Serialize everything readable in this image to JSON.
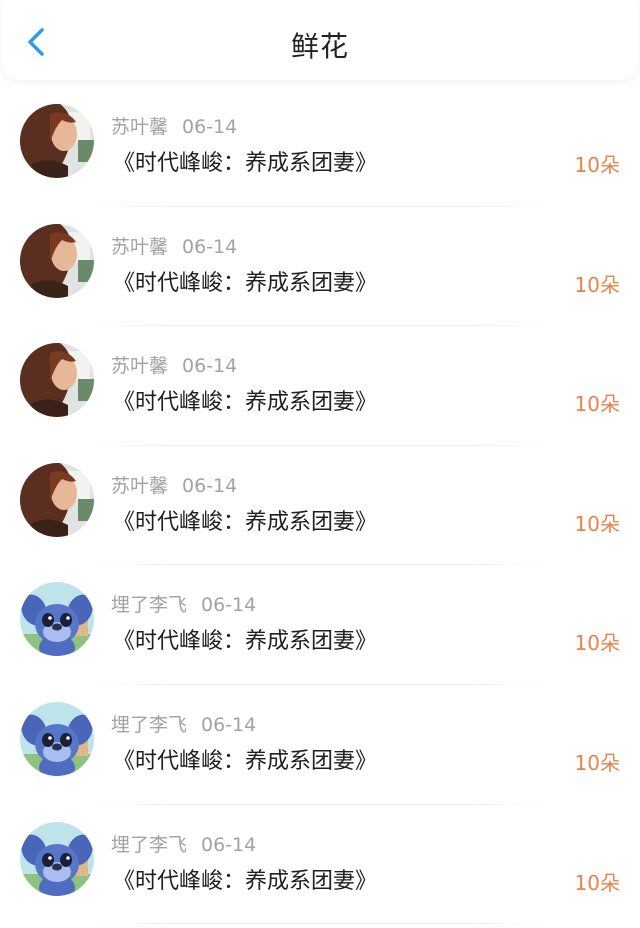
{
  "header": {
    "title": "鲜花",
    "back_icon": "chevron-left-icon",
    "accent_color": "#2b9de8"
  },
  "flowers": [
    {
      "user": "苏叶馨",
      "date": "06-14",
      "book": "《时代峰峻：养成系团妻》",
      "count": "10朵",
      "avatar": "woman-photo-avatar"
    },
    {
      "user": "苏叶馨",
      "date": "06-14",
      "book": "《时代峰峻：养成系团妻》",
      "count": "10朵",
      "avatar": "woman-photo-avatar"
    },
    {
      "user": "苏叶馨",
      "date": "06-14",
      "book": "《时代峰峻：养成系团妻》",
      "count": "10朵",
      "avatar": "woman-photo-avatar"
    },
    {
      "user": "苏叶馨",
      "date": "06-14",
      "book": "《时代峰峻：养成系团妻》",
      "count": "10朵",
      "avatar": "woman-photo-avatar"
    },
    {
      "user": "埋了李飞",
      "date": "06-14",
      "book": "《时代峰峻：养成系团妻》",
      "count": "10朵",
      "avatar": "blue-cartoon-avatar"
    },
    {
      "user": "埋了李飞",
      "date": "06-14",
      "book": "《时代峰峻：养成系团妻》",
      "count": "10朵",
      "avatar": "blue-cartoon-avatar"
    },
    {
      "user": "埋了李飞",
      "date": "06-14",
      "book": "《时代峰峻：养成系团妻》",
      "count": "10朵",
      "avatar": "blue-cartoon-avatar"
    }
  ]
}
